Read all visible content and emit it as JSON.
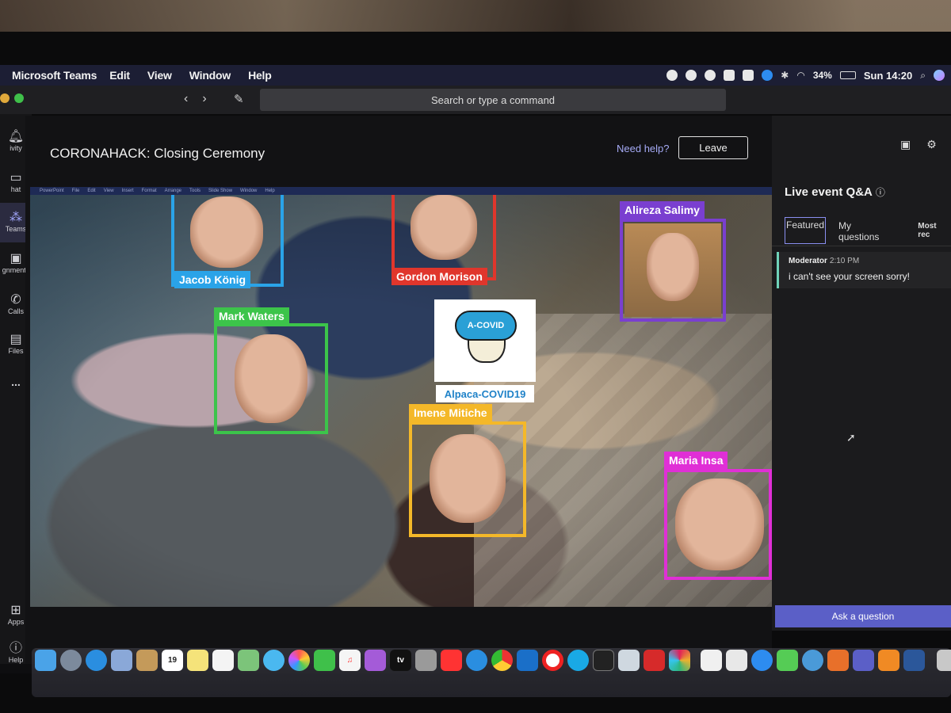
{
  "menubar": {
    "app_name": "Microsoft Teams",
    "menus": [
      "Edit",
      "View",
      "Window",
      "Help"
    ],
    "battery": "34%",
    "clock": "Sun 14:20"
  },
  "titlebar": {
    "search_placeholder": "Search or type a command"
  },
  "sidebar": {
    "items": [
      {
        "label": "ivity",
        "icon": "bell-icon"
      },
      {
        "label": "hat",
        "icon": "chat-icon"
      },
      {
        "label": "Teams",
        "icon": "teams-icon"
      },
      {
        "label": "gnments",
        "icon": "assignments-icon"
      },
      {
        "label": "Calls",
        "icon": "phone-icon"
      },
      {
        "label": "Files",
        "icon": "files-icon"
      },
      {
        "label": "...",
        "icon": "more-icon"
      },
      {
        "label": "Apps",
        "icon": "apps-icon"
      },
      {
        "label": "Help",
        "icon": "help-icon"
      }
    ]
  },
  "event": {
    "title": "CORONAHACK: Closing Ceremony",
    "need_help": "Need help?",
    "leave_label": "Leave"
  },
  "ppt_menu": [
    "PowerPoint",
    "File",
    "Edit",
    "View",
    "Insert",
    "Format",
    "Arrange",
    "Tools",
    "Slide Show",
    "Window",
    "Help"
  ],
  "slide": {
    "people": [
      {
        "name": "Jacob König",
        "color": "#2aa3e8"
      },
      {
        "name": "Gordon Morison",
        "color": "#e0362c"
      },
      {
        "name": "Alireza Salimy",
        "color": "#7a3fd0"
      },
      {
        "name": "Mark Waters",
        "color": "#3cc44a"
      },
      {
        "name": "Imene Mitiche",
        "color": "#f4b829"
      },
      {
        "name": "Maria Insa",
        "color": "#e02fd6"
      }
    ],
    "logo_text": "A-COVID",
    "logo_caption": "Alpaca-COVID19"
  },
  "qa": {
    "title": "Live event Q&A",
    "tabs": [
      "Featured",
      "My questions",
      "Most rec"
    ],
    "messages": [
      {
        "author": "Moderator",
        "time": "2:10 PM",
        "text": "i can't see your screen sorry!"
      }
    ],
    "ask_label": "Ask a question"
  },
  "dock": {
    "apps": [
      "finder",
      "launchpad",
      "safari",
      "preview",
      "notes-app",
      "calendar",
      "stickies",
      "reminders",
      "maps",
      "messages",
      "photos",
      "facetime",
      "music",
      "podcasts",
      "tv",
      "system-preferences",
      "news",
      "app-store",
      "chrome",
      "outlook",
      "opera",
      "skype",
      "terminal",
      "preview-image",
      "acrobat",
      "slack",
      "textedit",
      "pages",
      "teamviewer",
      "cmake",
      "pycharm",
      "matlab",
      "teams",
      "sublime",
      "word",
      "trash"
    ],
    "calendar_day": "19",
    "tv_label": "tv"
  },
  "colors": {
    "teams_accent": "#5b5fc7",
    "link": "#a5aaf5",
    "moderator_bar": "#6fd3b9"
  }
}
